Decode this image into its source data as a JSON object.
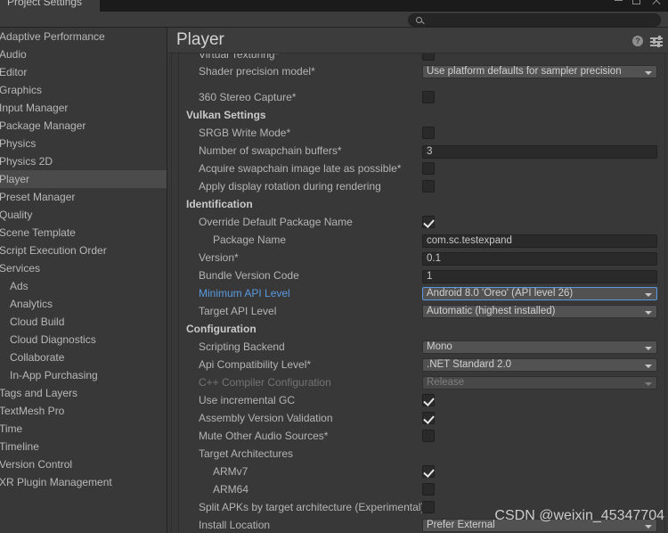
{
  "window": {
    "tab_label": "Project Settings",
    "min_icon": "minimize-icon",
    "max_icon": "maximize-icon",
    "close_icon": "close-icon"
  },
  "search": {
    "placeholder": "",
    "value": "",
    "icon": "search-icon"
  },
  "sidebar": {
    "items": [
      {
        "label": "Adaptive Performance",
        "selected": false,
        "child": false
      },
      {
        "label": "Audio",
        "selected": false,
        "child": false
      },
      {
        "label": "Editor",
        "selected": false,
        "child": false
      },
      {
        "label": "Graphics",
        "selected": false,
        "child": false
      },
      {
        "label": "Input Manager",
        "selected": false,
        "child": false
      },
      {
        "label": "Package Manager",
        "selected": false,
        "child": false
      },
      {
        "label": "Physics",
        "selected": false,
        "child": false
      },
      {
        "label": "Physics 2D",
        "selected": false,
        "child": false
      },
      {
        "label": "Player",
        "selected": true,
        "child": false
      },
      {
        "label": "Preset Manager",
        "selected": false,
        "child": false
      },
      {
        "label": "Quality",
        "selected": false,
        "child": false
      },
      {
        "label": "Scene Template",
        "selected": false,
        "child": false
      },
      {
        "label": "Script Execution Order",
        "selected": false,
        "child": false
      },
      {
        "label": "Services",
        "selected": false,
        "child": false
      },
      {
        "label": "Ads",
        "selected": false,
        "child": true
      },
      {
        "label": "Analytics",
        "selected": false,
        "child": true
      },
      {
        "label": "Cloud Build",
        "selected": false,
        "child": true
      },
      {
        "label": "Cloud Diagnostics",
        "selected": false,
        "child": true
      },
      {
        "label": "Collaborate",
        "selected": false,
        "child": true
      },
      {
        "label": "In-App Purchasing",
        "selected": false,
        "child": true
      },
      {
        "label": "Tags and Layers",
        "selected": false,
        "child": false
      },
      {
        "label": "TextMesh Pro",
        "selected": false,
        "child": false
      },
      {
        "label": "Time",
        "selected": false,
        "child": false
      },
      {
        "label": "Timeline",
        "selected": false,
        "child": false
      },
      {
        "label": "Version Control",
        "selected": false,
        "child": false
      },
      {
        "label": "XR Plugin Management",
        "selected": false,
        "child": false
      }
    ]
  },
  "panel": {
    "title": "Player",
    "help_icon": "help-icon",
    "preset_icon": "preset-settings-icon"
  },
  "settings": {
    "rows": [
      {
        "label": "Virtual Texturing*",
        "indent": 1,
        "type": "checkbox",
        "checked": false,
        "clipped_top": true
      },
      {
        "label": "Shader precision model*",
        "indent": 1,
        "type": "dropdown",
        "value": "Use platform defaults for sampler precision"
      },
      {
        "label": "",
        "indent": 1,
        "type": "spacer"
      },
      {
        "label": "360 Stereo Capture*",
        "indent": 1,
        "type": "checkbox",
        "checked": false
      },
      {
        "label": "Vulkan Settings",
        "indent": 0,
        "type": "section"
      },
      {
        "label": "SRGB Write Mode*",
        "indent": 1,
        "type": "checkbox",
        "checked": false
      },
      {
        "label": "Number of swapchain buffers*",
        "indent": 1,
        "type": "text",
        "value": "3"
      },
      {
        "label": "Acquire swapchain image late as possible*",
        "indent": 1,
        "type": "checkbox",
        "checked": false
      },
      {
        "label": "Apply display rotation during rendering",
        "indent": 1,
        "type": "checkbox",
        "checked": false
      },
      {
        "label": "Identification",
        "indent": 0,
        "type": "section"
      },
      {
        "label": "Override Default Package Name",
        "indent": 1,
        "type": "checkbox",
        "checked": true
      },
      {
        "label": "Package Name",
        "indent": 2,
        "type": "text",
        "value": "com.sc.testexpand"
      },
      {
        "label": "Version*",
        "indent": 1,
        "type": "text",
        "value": "0.1"
      },
      {
        "label": "Bundle Version Code",
        "indent": 1,
        "type": "text",
        "value": "1"
      },
      {
        "label": "Minimum API Level",
        "indent": 1,
        "type": "dropdown",
        "value": "Android 8.0 'Oreo' (API level 26)",
        "label_style": "link",
        "focused": true
      },
      {
        "label": "Target API Level",
        "indent": 1,
        "type": "dropdown",
        "value": "Automatic (highest installed)"
      },
      {
        "label": "Configuration",
        "indent": 0,
        "type": "section"
      },
      {
        "label": "Scripting Backend",
        "indent": 1,
        "type": "dropdown",
        "value": "Mono"
      },
      {
        "label": "Api Compatibility Level*",
        "indent": 1,
        "type": "dropdown",
        "value": ".NET Standard 2.0"
      },
      {
        "label": "C++ Compiler Configuration",
        "indent": 1,
        "type": "dropdown",
        "value": "Release",
        "disabled": true
      },
      {
        "label": "Use incremental GC",
        "indent": 1,
        "type": "checkbox",
        "checked": true
      },
      {
        "label": "Assembly Version Validation",
        "indent": 1,
        "type": "checkbox",
        "checked": true
      },
      {
        "label": "Mute Other Audio Sources*",
        "indent": 1,
        "type": "checkbox",
        "checked": false
      },
      {
        "label": "Target Architectures",
        "indent": 1,
        "type": "none"
      },
      {
        "label": "ARMv7",
        "indent": 2,
        "type": "checkbox",
        "checked": true
      },
      {
        "label": "ARM64",
        "indent": 2,
        "type": "checkbox",
        "checked": false
      },
      {
        "label": "Split APKs by target architecture (Experimental)",
        "indent": 1,
        "type": "checkbox",
        "checked": false
      },
      {
        "label": "Install Location",
        "indent": 1,
        "type": "dropdown",
        "value": "Prefer External"
      }
    ]
  },
  "watermark": {
    "text": "CSDN @weixin_45347704"
  }
}
